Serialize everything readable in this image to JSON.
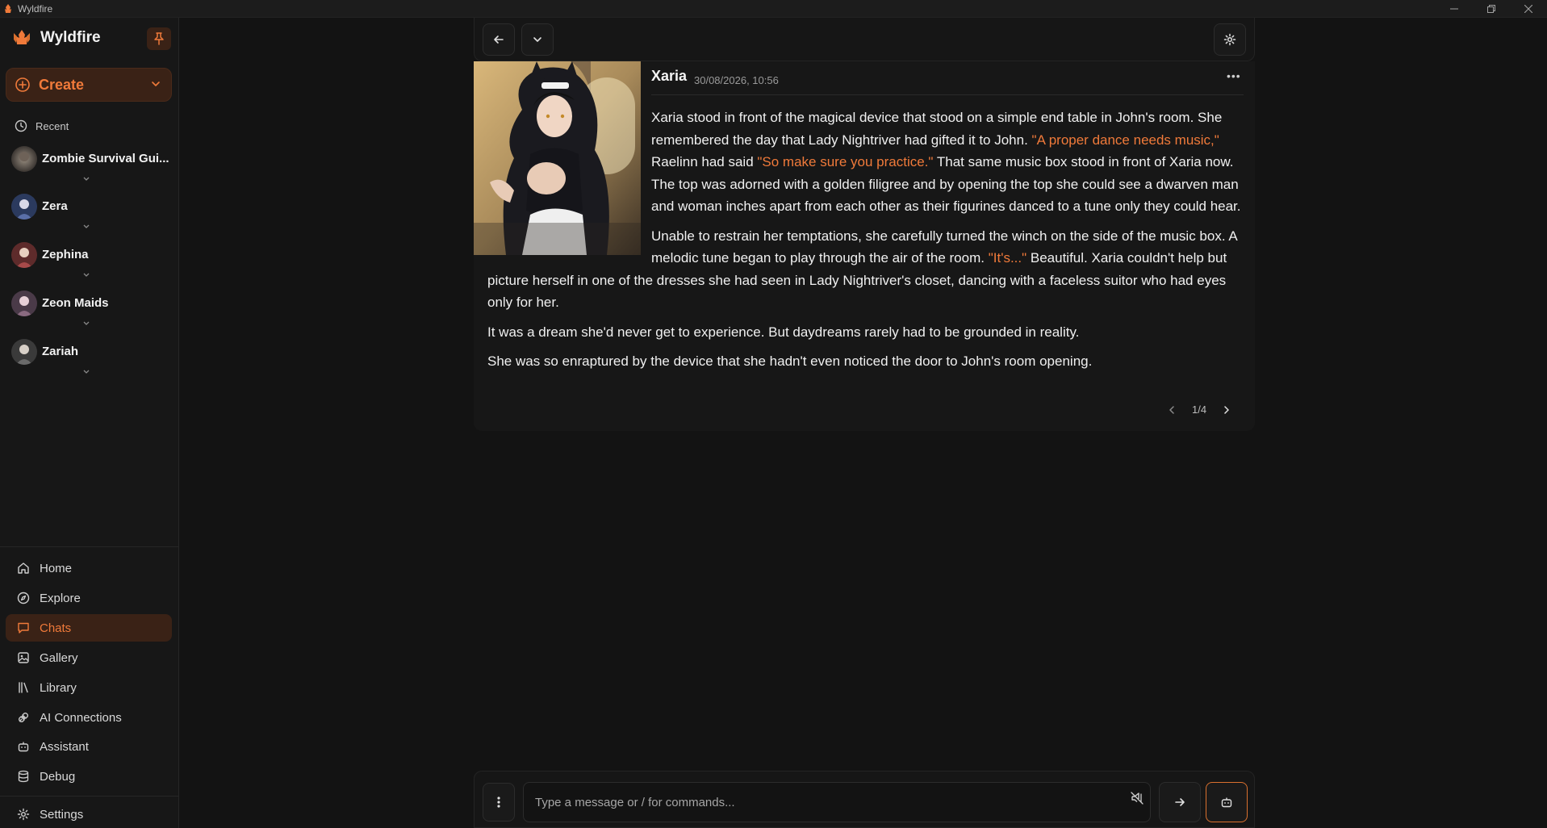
{
  "window": {
    "title": "Wyldfire"
  },
  "brand": {
    "name": "Wyldfire"
  },
  "create": {
    "label": "Create"
  },
  "recent": {
    "label": "Recent"
  },
  "chats": [
    {
      "name": "Zombie Survival Gui..."
    },
    {
      "name": "Zera"
    },
    {
      "name": "Zephina"
    },
    {
      "name": "Zeon Maids"
    },
    {
      "name": "Zariah"
    }
  ],
  "nav": {
    "home": "Home",
    "explore": "Explore",
    "chats": "Chats",
    "gallery": "Gallery",
    "library": "Library",
    "ai_connections": "AI Connections",
    "assistant": "Assistant",
    "debug": "Debug",
    "settings": "Settings"
  },
  "message": {
    "author": "Xaria",
    "timestamp": "30/08/2026, 10:56",
    "p1_a": "Xaria stood in front of the magical device that stood on a simple end table in John's room. She remembered the day that Lady Nightriver had gifted it to John. ",
    "p1_q1": "\"A proper dance needs music,\"",
    "p1_b": " Raelinn had said ",
    "p1_q2": "\"So make sure you practice.\"",
    "p1_c": " That same music box stood in front of Xaria now. The top was adorned with a golden filigree and by opening the top she could see a dwarven man and woman inches apart from each other as their figurines danced to a tune only they could hear.",
    "p2_a": "Unable to restrain her temptations, she carefully turned the winch on the side of the music box. A melodic tune began to play through the air of the room. ",
    "p2_q": "\"It's...\"",
    "p2_b": " Beautiful. Xaria couldn't help but picture herself in one of the dresses she had seen in Lady Nightriver's closet, dancing with a faceless suitor who had eyes only for her.",
    "p3": "It was a dream she'd never get to experience. But daydreams rarely had to be grounded in reality.",
    "p4": "She was so enraptured by the device that she hadn't even noticed the door to John's room opening.",
    "page": "1/4"
  },
  "composer": {
    "placeholder": "Type a message or / for commands..."
  },
  "colors": {
    "accent": "#f07a3a",
    "accent_bg": "#3a2216",
    "background": "#131313"
  }
}
